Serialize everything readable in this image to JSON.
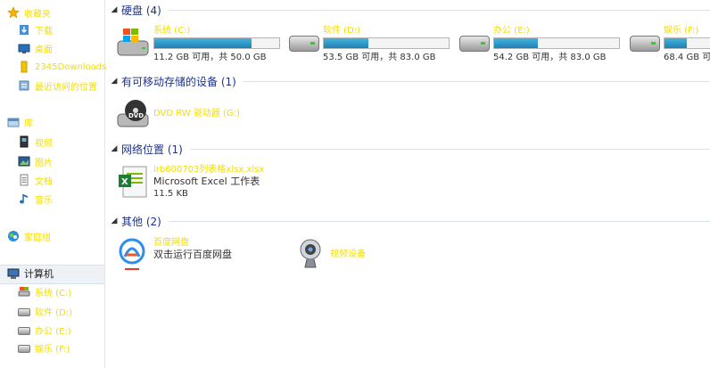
{
  "nav": {
    "favorites": {
      "title": "收藏夹",
      "items": [
        "下载",
        "桌面",
        "2345Downloads",
        "最近访问的位置"
      ]
    },
    "library": {
      "title": "库",
      "items": [
        "视频",
        "图片",
        "文档",
        "音乐"
      ]
    },
    "homegroup": {
      "title": "家庭组"
    },
    "computer": {
      "title": "计算机",
      "items": [
        "系统 (C:)",
        "软件 (D:)",
        "办公 (E:)",
        "娱乐 (F:)"
      ]
    }
  },
  "groups": {
    "hdd": "硬盘 (4)",
    "removable": "有可移动存储的设备 (1)",
    "network": "网络位置 (1)",
    "other": "其他 (2)"
  },
  "drives": [
    {
      "name": "系统 (C:)",
      "space": "11.2 GB 可用，共 50.0 GB",
      "used_fraction": 0.776
    },
    {
      "name": "软件 (D:)",
      "space": "53.5 GB 可用，共 83.0 GB",
      "used_fraction": 0.355
    },
    {
      "name": "办公 (E:)",
      "space": "54.2 GB 可用，共 83.0 GB",
      "used_fraction": 0.347
    },
    {
      "name": "娱乐 (F:)",
      "space": "68.4 GB 可用",
      "used_fraction": 0.176
    }
  ],
  "dvd": {
    "name": "DVD RW 驱动器 (G:)"
  },
  "network_file": {
    "name": "lrb600703列表格xlsx.xlsx",
    "type": "Microsoft Excel 工作表",
    "size": "11.5 KB"
  },
  "others": [
    {
      "name": "百度网盘",
      "desc": "双击运行百度网盘"
    },
    {
      "name": "视频设备"
    }
  ]
}
